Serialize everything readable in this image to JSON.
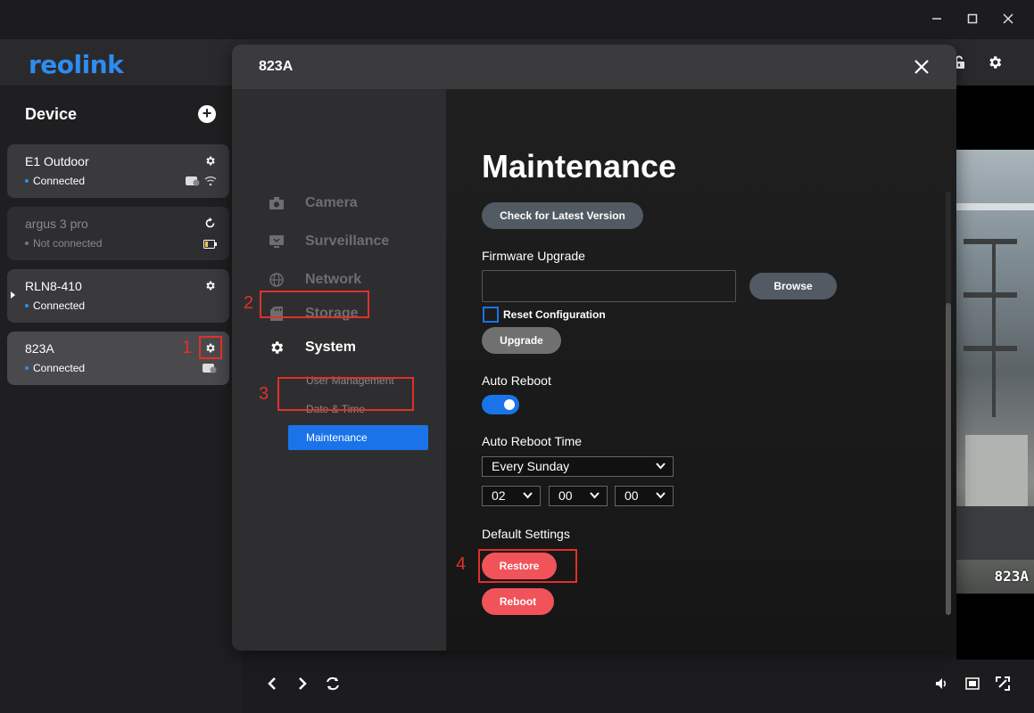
{
  "window_controls": {
    "minimize": "—",
    "maximize": "☐",
    "close": "✕"
  },
  "header": {
    "logo": "reolink"
  },
  "sidebar": {
    "title": "Device",
    "devices": [
      {
        "name": "E1 Outdoor",
        "status": "Connected"
      },
      {
        "name": "argus 3 pro",
        "status": "Not connected"
      },
      {
        "name": "RLN8-410",
        "status": "Connected"
      },
      {
        "name": "823A",
        "status": "Connected"
      }
    ]
  },
  "video": {
    "label": "823A"
  },
  "modal": {
    "title": "823A",
    "nav": {
      "items": [
        {
          "label": "Camera"
        },
        {
          "label": "Surveillance"
        },
        {
          "label": "Network"
        },
        {
          "label": "Storage"
        },
        {
          "label": "System"
        }
      ],
      "system_sub": [
        {
          "label": "User Management"
        },
        {
          "label": "Date & Time"
        },
        {
          "label": "Maintenance"
        }
      ]
    },
    "main": {
      "title": "Maintenance",
      "check_latest": "Check for Latest Version",
      "firmware_label": "Firmware Upgrade",
      "firmware_value": "",
      "browse": "Browse",
      "reset_config": "Reset Configuration",
      "upgrade": "Upgrade",
      "auto_reboot_label": "Auto Reboot",
      "auto_reboot_on": true,
      "reboot_time_label": "Auto Reboot Time",
      "reboot_day": "Every Sunday",
      "reboot_hour": "02",
      "reboot_min": "00",
      "reboot_sec": "00",
      "default_settings_label": "Default Settings",
      "restore": "Restore",
      "reboot": "Reboot"
    }
  },
  "annotations": [
    "1",
    "2",
    "3",
    "4"
  ],
  "colors": {
    "accent": "#1a73e8",
    "danger": "#f1535a",
    "annotation": "#e0302a",
    "logo": "#2e8cf0"
  }
}
